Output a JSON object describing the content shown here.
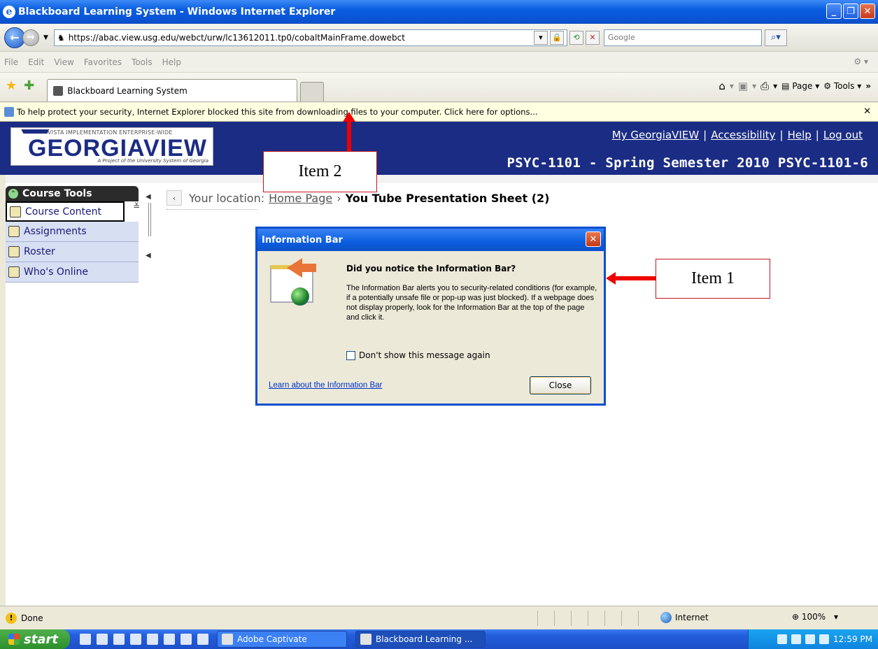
{
  "window": {
    "title": "Blackboard Learning System - Windows Internet Explorer"
  },
  "address_bar": {
    "url": "https://abac.view.usg.edu/webct/urw/lc13612011.tp0/cobaltMainFrame.dowebct",
    "search_placeholder": "Google"
  },
  "menu": [
    "File",
    "Edit",
    "View",
    "Favorites",
    "Tools",
    "Help"
  ],
  "tabs": {
    "active_label": "Blackboard Learning System",
    "page_label": "Page",
    "tools_label": "Tools"
  },
  "info_bar": {
    "message": "To help protect your security, Internet Explorer blocked this site from downloading files to your computer. Click here for options..."
  },
  "banner": {
    "logo_top": "VISTA IMPLEMENTATION ENTERPRISE-WIDE",
    "logo_main": "GEORGIAVIEW",
    "logo_sub": "A Project of the University System of Georgia",
    "links": [
      "My GeorgiaVIEW",
      "Accessibility",
      "Help",
      "Log out"
    ],
    "separator": "|",
    "course_title": "PSYC-1101 - Spring Semester 2010 PSYC-1101-6"
  },
  "sidebar": {
    "header": "Course Tools",
    "items": [
      {
        "label": "Course Content",
        "icon": "home-icon"
      },
      {
        "label": "Assignments",
        "icon": "assignment-icon"
      },
      {
        "label": "Roster",
        "icon": "people-icon"
      },
      {
        "label": "Who's Online",
        "icon": "online-icon"
      }
    ]
  },
  "breadcrumb": {
    "prefix": "Your location:",
    "home": "Home Page",
    "separator": "›",
    "current": "You Tube Presentation Sheet (2)"
  },
  "dialog": {
    "title": "Information Bar",
    "heading": "Did you notice the Information Bar?",
    "body": "The Information Bar alerts you to security-related conditions (for example, if a potentially unsafe file or pop-up was just blocked). If a webpage does not display properly, look for the Information Bar at the top of the page and click it.",
    "checkbox_label": "Don't show this message again",
    "link": "Learn about the Information Bar",
    "close_button": "Close"
  },
  "callouts": {
    "item1": "Item 1",
    "item2": "Item 2"
  },
  "status_bar": {
    "status": "Done",
    "zone": "Internet",
    "zoom": "100%"
  },
  "taskbar": {
    "start": "start",
    "tasks": [
      "Adobe Captivate",
      "Blackboard Learning ..."
    ],
    "clock": "12:59 PM"
  }
}
